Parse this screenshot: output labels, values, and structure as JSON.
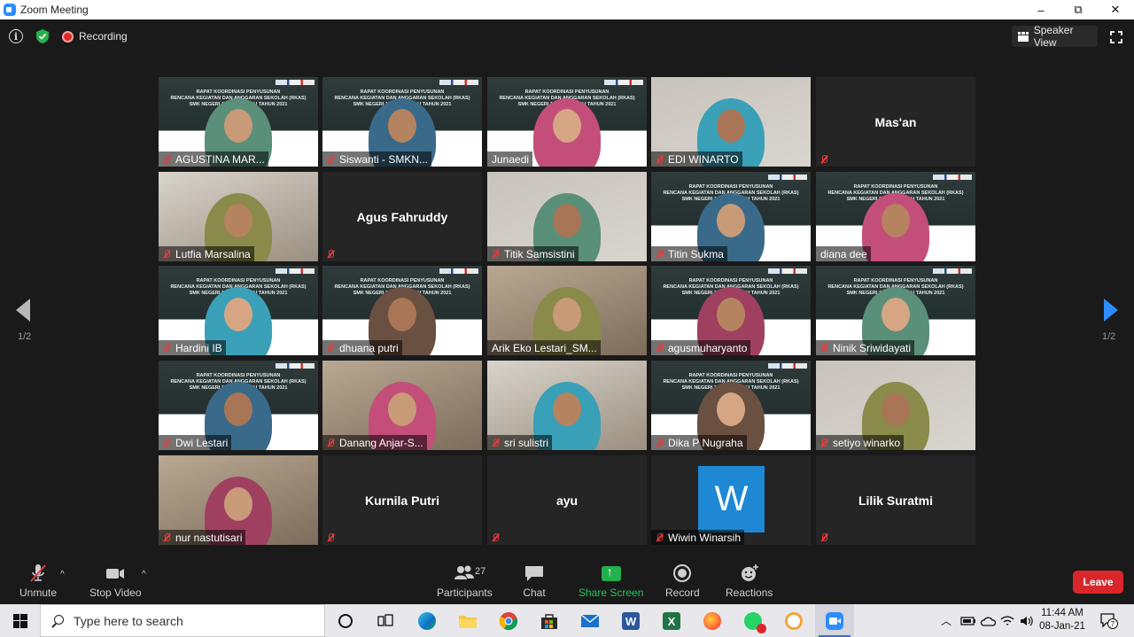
{
  "window": {
    "title": "Zoom Meeting",
    "minimize": "–",
    "maximize": "⧉",
    "close": "✕"
  },
  "topbar": {
    "recording_label": "Recording",
    "speaker_view_label": "Speaker View"
  },
  "pagination": {
    "left": "1/2",
    "right": "1/2"
  },
  "participants": [
    {
      "name": "AGUSTINA MAR...",
      "kind": "slide",
      "muted": true
    },
    {
      "name": "Siswanti - SMKN...",
      "kind": "slide",
      "muted": true
    },
    {
      "name": "Junaedi",
      "kind": "slide",
      "muted": false,
      "active": true
    },
    {
      "name": "EDI WINARTO",
      "kind": "video",
      "muted": true
    },
    {
      "name": "Mas'an",
      "kind": "name",
      "muted": true
    },
    {
      "name": "Lutfia Marsalina",
      "kind": "video",
      "muted": true
    },
    {
      "name": "Agus Fahruddy",
      "kind": "name",
      "muted": true
    },
    {
      "name": "Titik Samsistini",
      "kind": "video",
      "muted": true
    },
    {
      "name": "Titin Sukma",
      "kind": "slide",
      "muted": true
    },
    {
      "name": "diana dee",
      "kind": "slide",
      "muted": false
    },
    {
      "name": "Hardini IB",
      "kind": "slide",
      "muted": true
    },
    {
      "name": "dhuana putri",
      "kind": "slide",
      "muted": true
    },
    {
      "name": "Arik Eko Lestari_SM...",
      "kind": "video",
      "muted": false
    },
    {
      "name": "agusmuharyanto",
      "kind": "slide",
      "muted": true
    },
    {
      "name": "Ninik Sriwidayati",
      "kind": "slide",
      "muted": true
    },
    {
      "name": "Dwi Lestari",
      "kind": "slide",
      "muted": true
    },
    {
      "name": "Danang Anjar-S...",
      "kind": "video",
      "muted": true
    },
    {
      "name": "sri sulistri",
      "kind": "video",
      "muted": true
    },
    {
      "name": "Dika P Nugraha",
      "kind": "slide",
      "muted": true
    },
    {
      "name": "setiyo winarko",
      "kind": "video",
      "muted": true
    },
    {
      "name": "nur nastutisari",
      "kind": "video",
      "muted": true
    },
    {
      "name": "Kurnila Putri",
      "kind": "name",
      "muted": true
    },
    {
      "name": "ayu",
      "kind": "name",
      "muted": true
    },
    {
      "name": "Wiwin Winarsih",
      "kind": "avatar",
      "muted": true,
      "avatar_letter": "W"
    },
    {
      "name": "Lilik Suratmi",
      "kind": "name",
      "muted": true
    }
  ],
  "slide_text": {
    "line1": "RAPAT KOORDINASI PENYUSUNAN",
    "line2": "RENCANA KEGIATAN DAN ANGGARAN SEKOLAH (RKAS)",
    "line3": "SMK NEGERI 1 BOYOLANGU TAHUN 2021"
  },
  "toolbar": {
    "unmute": "Unmute",
    "stop_video": "Stop Video",
    "participants": "Participants",
    "participant_count": "27",
    "chat": "Chat",
    "share_screen": "Share Screen",
    "record": "Record",
    "reactions": "Reactions",
    "leave": "Leave"
  },
  "taskbar": {
    "search_placeholder": "Type here to search",
    "time": "11:44 AM",
    "date": "08-Jan-21",
    "notification_count": "7"
  },
  "colors": {
    "zoom_blue": "#2d8cff",
    "leave_red": "#d9262b",
    "share_green": "#22b14c",
    "active_speaker": "#dfe84a",
    "muted_red": "#e83b3b"
  }
}
